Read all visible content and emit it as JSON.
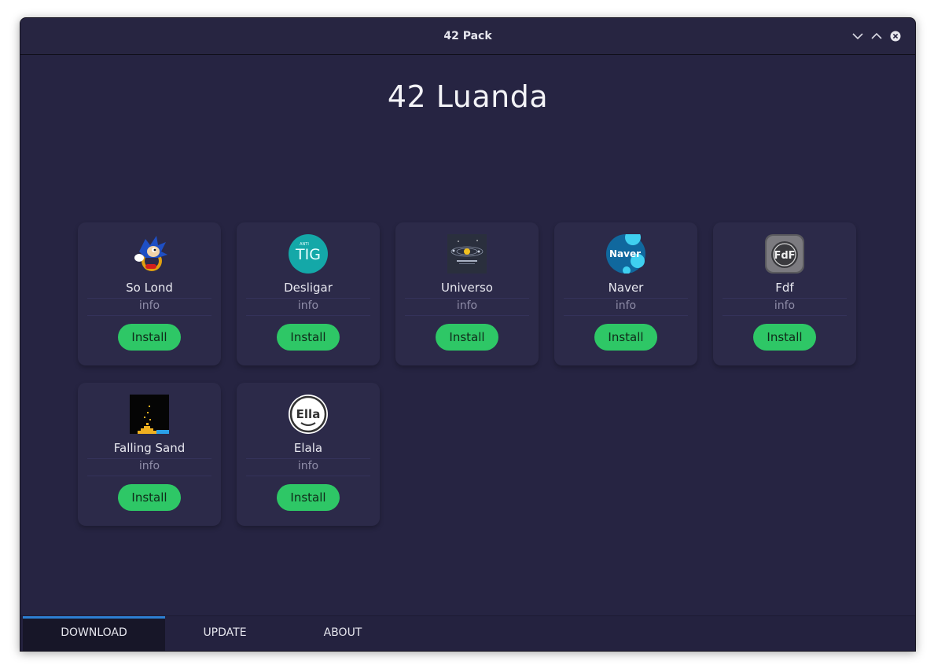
{
  "window": {
    "title": "42 Pack"
  },
  "main": {
    "heading": "42 Luanda",
    "apps": [
      {
        "name": "So Lond",
        "info": "info",
        "button": "Install",
        "icon": "sonic-icon"
      },
      {
        "name": "Desligar",
        "info": "info",
        "button": "Install",
        "icon": "tig-icon",
        "icon_text": "TIG",
        "icon_small_text": "ANTI"
      },
      {
        "name": "Universo",
        "info": "info",
        "button": "Install",
        "icon": "solar-system-icon"
      },
      {
        "name": "Naver",
        "info": "info",
        "button": "Install",
        "icon": "naver-icon",
        "icon_text": "Naver"
      },
      {
        "name": "Fdf",
        "info": "info",
        "button": "Install",
        "icon": "fdf-icon",
        "icon_text": "FdF"
      },
      {
        "name": "Falling Sand",
        "info": "info",
        "button": "Install",
        "icon": "falling-sand-icon"
      },
      {
        "name": "Elala",
        "info": "info",
        "button": "Install",
        "icon": "ella-icon",
        "icon_text": "Ella"
      }
    ]
  },
  "tabs": [
    {
      "label": "DOWNLOAD",
      "active": true
    },
    {
      "label": "UPDATE",
      "active": false
    },
    {
      "label": "ABOUT",
      "active": false
    }
  ],
  "colors": {
    "background": "#262442",
    "card": "#2c2a49",
    "install_button": "#2ec766",
    "active_tab_indicator": "#2d7fd2"
  }
}
